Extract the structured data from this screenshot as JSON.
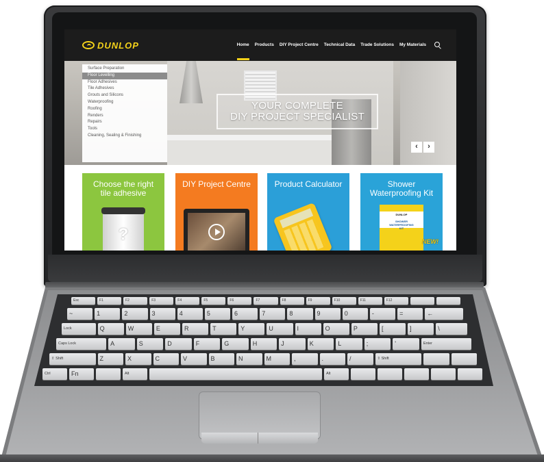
{
  "site": {
    "logo_text": "DUNLOP",
    "nav": [
      "Home",
      "Products",
      "DIY Project Centre",
      "Technical Data",
      "Trade Solutions",
      "My Materials"
    ],
    "active_nav": "Home",
    "search_icon": "search-icon"
  },
  "categories": [
    "Surface Preparation",
    "Floor Levelling",
    "Floor Adhesives",
    "Tile Adhesives",
    "Grouts and Silicons",
    "Waterproofing",
    "Roofing",
    "Renders",
    "Repairs",
    "Tools",
    "Cleaning, Sealing & Finishing"
  ],
  "active_category": "Floor Levelling",
  "hero": {
    "line1": "YOUR COMPLETE",
    "line2": "DIY PROJECT SPECIALIST",
    "prev_label": "‹",
    "next_label": "›"
  },
  "tiles": [
    {
      "title_line1": "Choose the right",
      "title_line2": "tile adhesive",
      "color": "#8cc63f"
    },
    {
      "title_line1": "DIY Project Centre",
      "title_line2": "",
      "color": "#f47b20"
    },
    {
      "title_line1": "Product Calculator",
      "title_line2": "",
      "color": "#2b9fd8"
    },
    {
      "title_line1": "Shower",
      "title_line2": "Waterproofing Kit",
      "color": "#2aa3d8"
    }
  ],
  "tile_product": {
    "brand": "DUNLOP",
    "name_line1": "SHOWER",
    "name_line2": "WATERPROOFING",
    "name_line3": "KIT",
    "badge": "NEW!"
  },
  "keyboard": {
    "row1": [
      "Esc",
      "F1",
      "F2",
      "F3",
      "F4",
      "F5",
      "F6",
      "F7",
      "F8",
      "F9",
      "F10",
      "F11",
      "F12",
      "",
      ""
    ],
    "row2": [
      "~",
      "1",
      "2",
      "3",
      "4",
      "5",
      "6",
      "7",
      "8",
      "9",
      "0",
      "-",
      "=",
      "←"
    ],
    "row3": [
      "Lock",
      "Q",
      "W",
      "E",
      "R",
      "T",
      "Y",
      "U",
      "I",
      "O",
      "P",
      "[",
      "]",
      "\\"
    ],
    "row4": [
      "Caps Lock",
      "A",
      "S",
      "D",
      "F",
      "G",
      "H",
      "J",
      "K",
      "L",
      ";",
      "'",
      "Enter"
    ],
    "row5": [
      "⇧ Shift",
      "Z",
      "X",
      "C",
      "V",
      "B",
      "N",
      "M",
      ",",
      ".",
      "/",
      "⇧ Shift",
      "",
      ""
    ],
    "row6": [
      "Ctrl",
      "Fn",
      "",
      "Alt",
      "",
      "Alt",
      "",
      "",
      "",
      "",
      ""
    ]
  },
  "colors": {
    "brand_yellow": "#f4d21a",
    "header_bg": "#1c1c1c"
  }
}
